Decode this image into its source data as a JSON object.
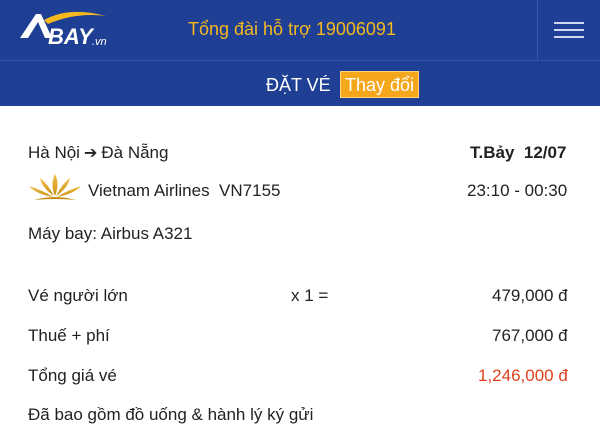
{
  "header": {
    "logo_text": "BAY",
    "logo_suffix": ".vn",
    "hotline": "Tổng đài hỗ trợ 19006091",
    "menu_icon": "hamburger-menu-icon"
  },
  "booking_bar": {
    "title": "ĐẶT VÉ",
    "change_label": "Thay đổi"
  },
  "flight": {
    "origin": "Hà Nội",
    "arrow_glyph": "➔",
    "destination": "Đà Nẵng",
    "day": "T.Bảy",
    "date": "12/07",
    "airline_logo_icon": "vietnam-airlines-lotus-icon",
    "airline": "Vietnam Airlines",
    "flight_no": "VN7155",
    "time_range": "23:10 - 00:30",
    "aircraft": "Máy bay: Airbus A321"
  },
  "pricing": {
    "adult_label": "Vé người lớn",
    "adult_qty": "x 1 =",
    "adult_price": "479,000 đ",
    "tax_label": "Thuế + phí",
    "tax_price": "767,000 đ",
    "total_label": "Tổng giá vé",
    "total_price": "1,246,000 đ",
    "note": "Đã bao gồm đồ uống & hành lý ký gửi"
  },
  "colors": {
    "header_bg": "#1e3f93",
    "hotline": "#f5b81f",
    "change_button": "#f5a71b",
    "total_price": "#e0401e"
  }
}
